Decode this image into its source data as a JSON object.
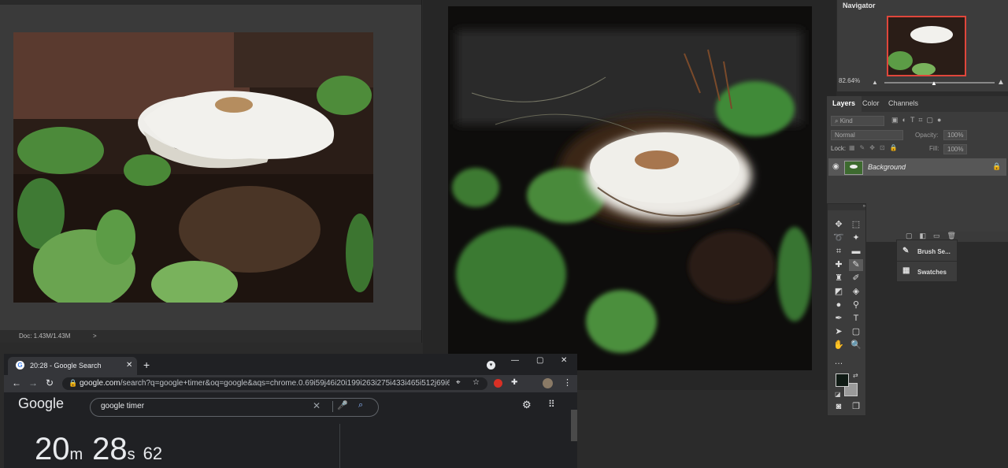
{
  "left_doc": {
    "status": "Doc: 1.43M/1.43M",
    "status_arrow": ">"
  },
  "navigator": {
    "title": "Navigator",
    "zoom": "82.64%"
  },
  "layers_panel": {
    "tabs": [
      "Layers",
      "Color",
      "Channels"
    ],
    "kind_filter": "Kind",
    "blend_mode": "Normal",
    "opacity_label": "Opacity:",
    "opacity_value": "100%",
    "lock_label": "Lock:",
    "fill_label": "Fill:",
    "fill_value": "100%",
    "layer_name": "Background"
  },
  "float_panel": {
    "items": [
      "Brush Se...",
      "Swatches"
    ]
  },
  "browser": {
    "tab_title": "20:28 - Google Search",
    "url_domain": "google.com",
    "url_rest": "/search?q=google+timer&oq=google&aqs=chrome.0.69i59j46i20i199i263i275i433i465i512j69i60l...",
    "logo": "Google",
    "search_query": "google timer",
    "timer": {
      "minutes": "20",
      "minutes_unit": "m",
      "seconds": "28",
      "seconds_unit": "s",
      "centis": "62"
    }
  },
  "colors": {
    "accent_red": "#e0463b",
    "ps_panel": "#3c3c3c",
    "chrome_dark": "#202124"
  }
}
